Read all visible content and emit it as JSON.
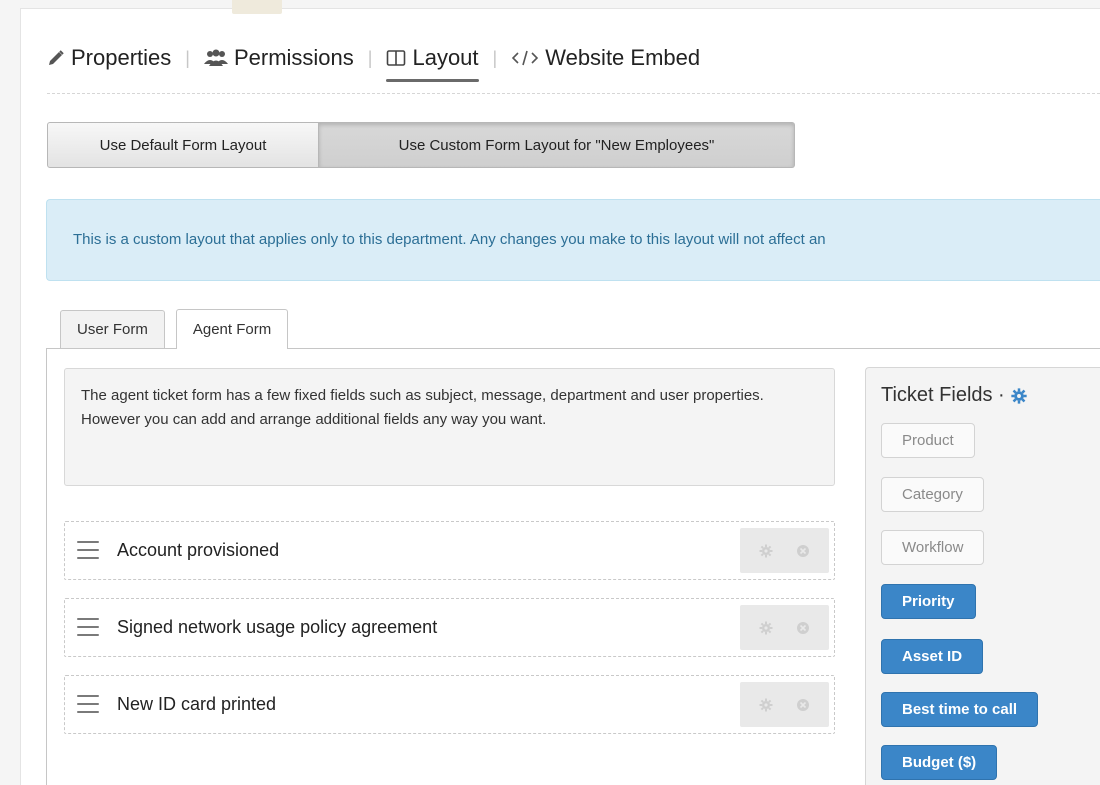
{
  "nav": {
    "tabs": [
      {
        "label": "Properties",
        "icon": "pencil-icon"
      },
      {
        "label": "Permissions",
        "icon": "users-icon"
      },
      {
        "label": "Layout",
        "icon": "columns-icon",
        "active": true
      },
      {
        "label": "Website Embed",
        "icon": "code-icon"
      }
    ],
    "separator": "|"
  },
  "layout_switch": {
    "default_label": "Use Default Form Layout",
    "custom_label": "Use Custom Form Layout for \"New Employees\"",
    "selected": "custom"
  },
  "alert": {
    "text": "This is a custom layout that applies only to this department. Any changes you make to this layout will not affect an"
  },
  "form_tabs": {
    "user_label": "User Form",
    "agent_label": "Agent Form",
    "active": "agent"
  },
  "description": "The agent ticket form has a few fixed fields such as subject, message, department and user properties. However you can add and arrange additional fields any way you want.",
  "fields": [
    {
      "label": "Account provisioned"
    },
    {
      "label": "Signed network usage policy agreement"
    },
    {
      "label": "New ID card printed"
    }
  ],
  "ticket_fields": {
    "title": "Ticket Fields ·",
    "items": [
      {
        "label": "Product",
        "enabled": false
      },
      {
        "label": "Category",
        "enabled": false
      },
      {
        "label": "Workflow",
        "enabled": false
      },
      {
        "label": "Priority",
        "enabled": true
      },
      {
        "label": "Asset ID",
        "enabled": true
      },
      {
        "label": "Best time to call",
        "enabled": true
      },
      {
        "label": "Budget ($)",
        "enabled": true
      }
    ]
  },
  "colors": {
    "accent": "#3b86c8",
    "alert_bg": "#daedf7",
    "alert_text": "#2c6f96"
  }
}
